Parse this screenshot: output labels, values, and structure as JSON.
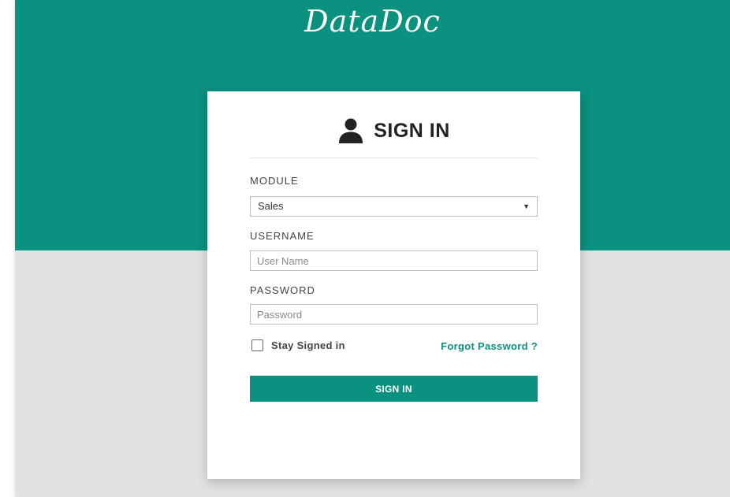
{
  "app": {
    "logo_text": "DataDoc"
  },
  "colors": {
    "brand": "#0b9180",
    "background": "#e2e2e2",
    "card": "#ffffff"
  },
  "signin_card": {
    "title": "SIGN IN",
    "icon": "user-icon",
    "module": {
      "label": "MODULE",
      "selected": "Sales",
      "arrow": "▼"
    },
    "username": {
      "label": "USERNAME",
      "value": "",
      "placeholder": "User Name"
    },
    "password": {
      "label": "PASSWORD",
      "value": "",
      "placeholder": "Password"
    },
    "stay_signed_in": {
      "label": "Stay Signed in",
      "checked": false
    },
    "forgot_password": "Forgot Password ?",
    "submit_label": "SIGN IN"
  }
}
